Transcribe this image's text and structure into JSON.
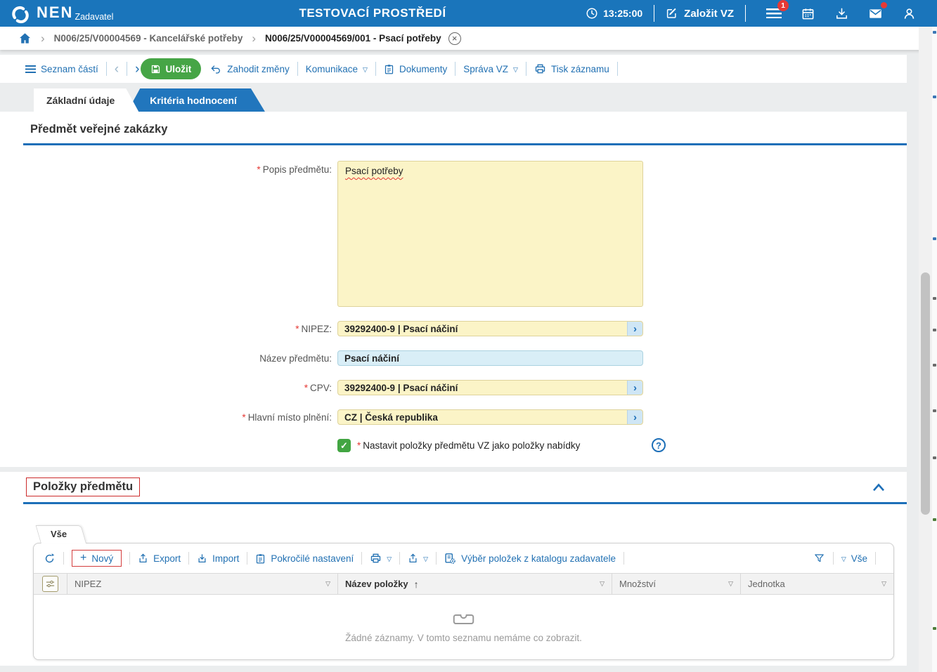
{
  "topbar": {
    "logo": "NEN",
    "logo_sub": "Zadavatel",
    "env_title": "TESTOVACÍ PROSTŘEDÍ",
    "time": "13:25:00",
    "create_vz": "Založit VZ",
    "menu_badge": "1"
  },
  "breadcrumb": {
    "item1": "N006/25/V00004569 - Kancelářské potřeby",
    "item2": "N006/25/V00004569/001 - Psací potřeby"
  },
  "cmdbar": {
    "seznam_casti": "Seznam částí",
    "ulozit": "Uložit",
    "zahodit": "Zahodit změny",
    "komunikace": "Komunikace",
    "dokumenty": "Dokumenty",
    "sprava_vz": "Správa VZ",
    "tisk": "Tisk záznamu"
  },
  "tabs": {
    "zakladni": "Základní údaje",
    "kriteria": "Kritéria hodnocení"
  },
  "section1": {
    "title": "Předmět veřejné zakázky",
    "popis_label": "Popis předmětu:",
    "popis_value": "Psací potřeby",
    "nipez_label": "NIPEZ:",
    "nipez_value": "39292400-9 | Psací náčiní",
    "nazev_label": "Název předmětu:",
    "nazev_value": "Psací náčiní",
    "cpv_label": "CPV:",
    "cpv_value": "39292400-9 | Psací náčiní",
    "misto_label": "Hlavní místo plnění:",
    "misto_value": "CZ | Česká republika",
    "checkbox_label": "Nastavit položky předmětu VZ jako položky nabídky",
    "checkbox_checked": "true"
  },
  "section2": {
    "title": "Položky předmětu",
    "filter_tab": "Vše",
    "toolbar": {
      "novy": "Nový",
      "export": "Export",
      "import": "Import",
      "pokrocile": "Pokročilé nastavení",
      "vyber": "Výběr položek z katalogu zadavatele",
      "vse": "Vše"
    },
    "table": {
      "columns": [
        "NIPEZ",
        "Název položky",
        "Množství",
        "Jednotka"
      ],
      "empty_text": "Žádné záznamy. V tomto seznamu nemáme co zobrazit."
    }
  },
  "icons": {
    "required": "*",
    "caret_down": "▽",
    "sort_asc": "↑",
    "chevron_left": "‹",
    "chevron_right": "›",
    "breadcrumb_sep": "›",
    "lookup": "›",
    "close": "×",
    "check": "✓",
    "plus": "+",
    "question": "?"
  },
  "colors": {
    "header_blue": "#1a75bb",
    "accent_blue": "#2271b3",
    "section_border_blue": "#1d6fb8",
    "save_green": "#46a546",
    "checkbox_green": "#42a542",
    "field_yellow": "#fbf4c7",
    "field_cyan": "#d9eef7",
    "highlight_red": "#d43c3c",
    "badge_red": "#e53935"
  }
}
